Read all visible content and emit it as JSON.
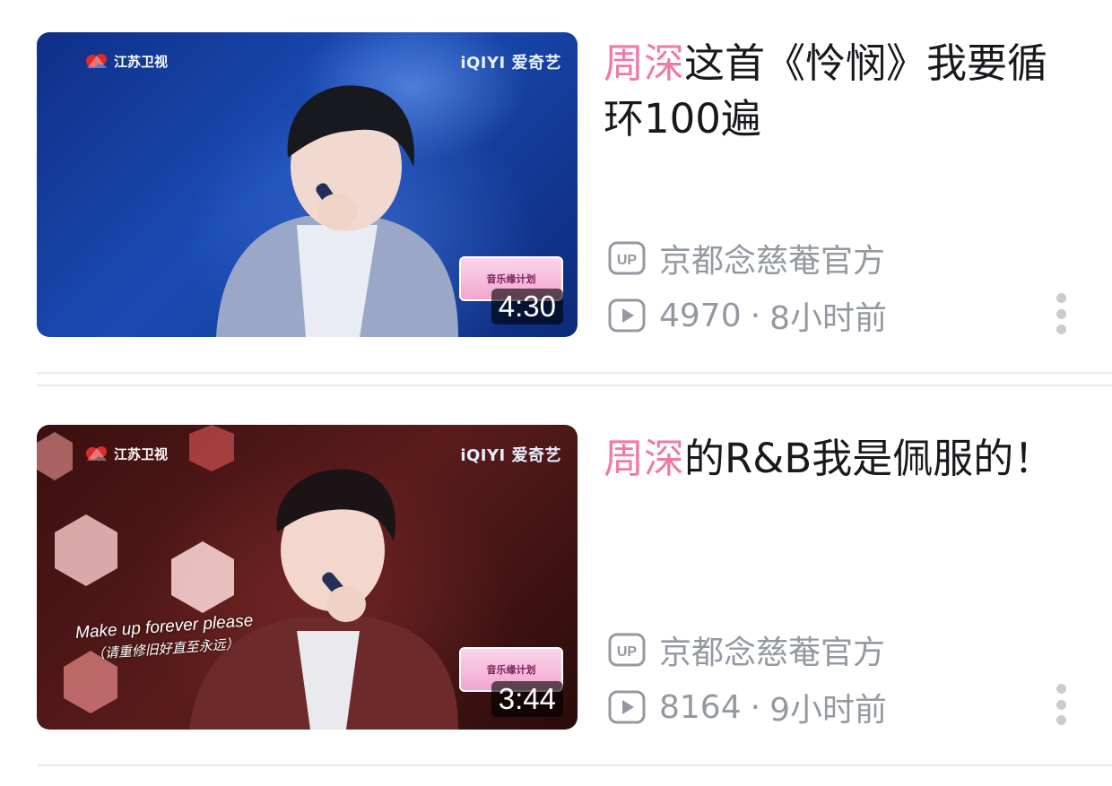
{
  "feed": {
    "videos": [
      {
        "title_highlight": "周深",
        "title_rest": "这首《怜悯》我要循环100遍",
        "uploader": "京都念慈菴官方",
        "views": "4970",
        "separator": "·",
        "time_ago": "8小时前",
        "duration": "4:30",
        "thumb": {
          "station_logo": "江苏卫视",
          "platform_logo": "iQIYI 爱奇艺",
          "show_logo": "音乐缘计划"
        }
      },
      {
        "title_highlight": "周深",
        "title_rest": "的R&B我是佩服的！",
        "uploader": "京都念慈菴官方",
        "views": "8164",
        "separator": "·",
        "time_ago": "9小时前",
        "duration": "3:44",
        "thumb": {
          "station_logo": "江苏卫视",
          "platform_logo": "iQIYI 爱奇艺",
          "show_logo": "音乐缘计划",
          "lyric_en": "Make up forever please",
          "lyric_zh": "（请重修旧好直至永远）"
        }
      }
    ]
  },
  "icons": {
    "up": "up-badge-icon",
    "play": "play-count-icon",
    "more": "more-vertical-icon"
  },
  "colors": {
    "highlight": "#f07aa6",
    "title": "#18191c",
    "meta": "#9499a0"
  }
}
